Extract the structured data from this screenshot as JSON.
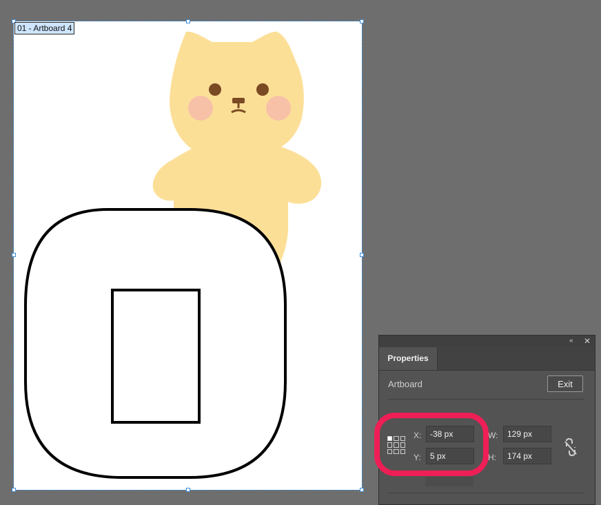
{
  "artboard": {
    "label": "01 - Artboard 4"
  },
  "properties_panel": {
    "collapse_icon": "«",
    "close_icon": "✕",
    "tab_label": "Properties",
    "section_title": "Artboard",
    "exit_button": "Exit",
    "x_label": "X:",
    "x_value": "-38 px",
    "y_label": "Y:",
    "y_value": "5 px",
    "w_label": "W:",
    "w_value": "129 px",
    "h_label": "H:",
    "h_value": "174 px",
    "link_icon": "unlink-proportions-icon"
  },
  "colors": {
    "highlight": "#ee1f56",
    "selection": "#3a8bd6",
    "bear": "#fcdf97",
    "blush": "#f7c1a7"
  }
}
